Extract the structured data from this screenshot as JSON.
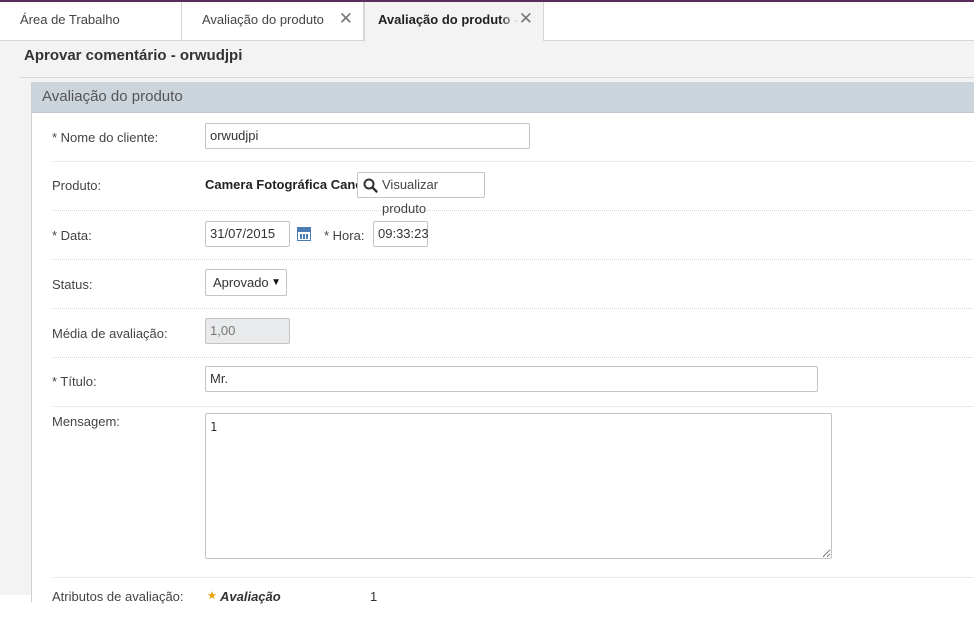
{
  "tabs": [
    {
      "label": "Área de Trabalho",
      "closable": false
    },
    {
      "label": "Avaliação do produto",
      "closable": true
    },
    {
      "label": "Avaliação do produto - orwudjpi",
      "closable": true,
      "active": true
    }
  ],
  "page": {
    "title": "Aprovar comentário - orwudjpi",
    "panel_title": "Avaliação do produto"
  },
  "form": {
    "customer_label": "* Nome do cliente:",
    "customer_value": "orwudjpi",
    "product_label": "Produto:",
    "product_name": "Camera Fotográfica Canon",
    "view_product_label": "Visualizar produto",
    "date_label": "* Data:",
    "date_value": "31/07/2015",
    "time_label": "* Hora:",
    "time_value": "09:33:23",
    "status_label": "Status:",
    "status_value": "Aprovado",
    "rating_label": "Média de avaliação:",
    "rating_value": "1,00",
    "title_label": "* Título:",
    "title_value": "Mr.",
    "message_label": "Mensagem:",
    "message_value": "1",
    "attributes_label": "Atributos de avaliação:",
    "attribute_name": "Avaliação",
    "attribute_value": "1"
  },
  "colors": {
    "accent": "#5b2a5e",
    "panel_header": "#cdd5dc"
  },
  "icons": {
    "search": "search-icon",
    "calendar": "calendar-icon",
    "close": "close-icon",
    "dropdown": "caret-down-icon",
    "star": "star-icon"
  }
}
